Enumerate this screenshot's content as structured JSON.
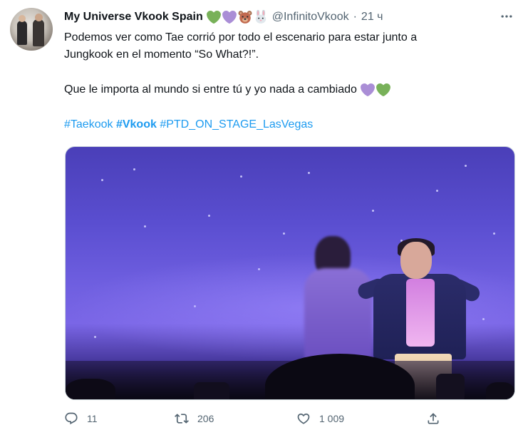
{
  "tweet": {
    "author_name": "My Universe Vkook Spain",
    "author_emojis": [
      "green-heart",
      "purple-heart",
      "bear-face",
      "rabbit-face"
    ],
    "handle": "@InfinitoVkook",
    "separator": "·",
    "time": "21 ч",
    "text_line1": "Podemos ver como Tae corrió por todo el escenario para estar junto a",
    "text_line2": "Jungkook en el momento “So What?!”.",
    "text_para2": "Que le importa al mundo si entre tú y yo nada a cambiado",
    "text_para2_emojis": [
      "purple-heart",
      "green-heart"
    ],
    "hashtags": [
      {
        "label": "#Taekook",
        "bold": false
      },
      {
        "label": "#Vkook",
        "bold": true
      },
      {
        "label": "#PTD_ON_STAGE_LasVegas",
        "bold": false
      }
    ]
  },
  "actions": {
    "reply_count": "11",
    "retweet_count": "206",
    "like_count": "1 009",
    "share_label": ""
  },
  "colors": {
    "link": "#1d9bf0",
    "secondary_text": "#536471",
    "green_heart": "#78b159",
    "purple_heart": "#aa8ed6"
  }
}
